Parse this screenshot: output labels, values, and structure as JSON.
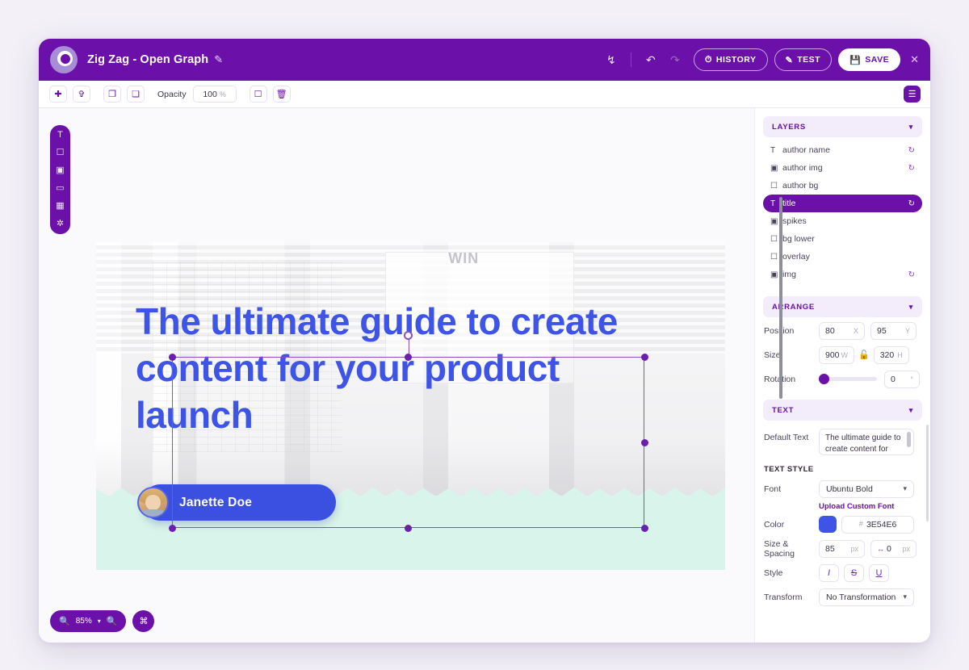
{
  "header": {
    "doc_title": "Zig Zag - Open Graph",
    "edit_icon": "pencil-icon",
    "download_icon": "download-icon",
    "undo_icon": "undo-icon",
    "redo_icon": "redo-icon",
    "history_label": "HISTORY",
    "history_icon": "clock-icon",
    "test_label": "TEST",
    "test_icon": "wand-icon",
    "save_label": "SAVE",
    "save_icon": "floppy-disk-icon",
    "close_icon": "close-icon"
  },
  "toolbar": {
    "align_horizontal_icon": "align-horizontal-icon",
    "align_vertical_icon": "align-vertical-icon",
    "bring_forward_icon": "bring-forward-icon",
    "send_backward_icon": "send-backward-icon",
    "opacity_label": "Opacity",
    "opacity_value": "100",
    "opacity_unit": "%",
    "duplicate_icon": "duplicate-icon",
    "delete_icon": "trash-icon",
    "menu_icon": "hamburger-menu-icon"
  },
  "left_tools": [
    {
      "name": "text-tool",
      "glyph": "T"
    },
    {
      "name": "rectangle-tool",
      "glyph": "▢"
    },
    {
      "name": "image-tool",
      "glyph": "▣"
    },
    {
      "name": "rounded-rect-tool",
      "glyph": "▭"
    },
    {
      "name": "qr-code-tool",
      "glyph": "▞"
    },
    {
      "name": "sticker-tool",
      "glyph": "✪"
    }
  ],
  "canvas": {
    "title_text": "The ultimate guide to create content for your product launch",
    "author_name": "Janette Doe",
    "photo_word": "WIN",
    "title_color": "#3E54E6",
    "author_chip_color": "#3b4fe0",
    "band_color": "#d9f4ea",
    "zoom_level": "85%",
    "zoom_out_icon": "zoom-out-icon",
    "zoom_in_icon": "zoom-in-icon",
    "zoom_chevron_icon": "chevron-down-icon",
    "fit_icon": "fit-to-screen-icon"
  },
  "layers_panel": {
    "title": "LAYERS",
    "chevron": "⌄",
    "items": [
      {
        "label": "author name",
        "icon": "text-layer-icon",
        "glyph": "T",
        "refresh": true,
        "active": false
      },
      {
        "label": "author img",
        "icon": "image-layer-icon",
        "glyph": "▣",
        "refresh": true,
        "active": false
      },
      {
        "label": "author bg",
        "icon": "shape-layer-icon",
        "glyph": "▢",
        "refresh": false,
        "active": false
      },
      {
        "label": "title",
        "icon": "text-layer-icon",
        "glyph": "T",
        "refresh": true,
        "active": true
      },
      {
        "label": "spikes",
        "icon": "image-layer-icon",
        "glyph": "▣",
        "refresh": false,
        "active": false
      },
      {
        "label": "bg lower",
        "icon": "shape-layer-icon",
        "glyph": "▢",
        "refresh": false,
        "active": false
      },
      {
        "label": "overlay",
        "icon": "shape-layer-icon",
        "glyph": "▢",
        "refresh": false,
        "active": false
      },
      {
        "label": "img",
        "icon": "image-layer-icon",
        "glyph": "▣",
        "refresh": true,
        "active": false
      }
    ]
  },
  "arrange_panel": {
    "title": "ARRANGE",
    "chevron": "⌄",
    "position_label": "Position",
    "position_x": "80",
    "position_x_unit": "X",
    "position_y": "95",
    "position_y_unit": "Y",
    "size_label": "Size",
    "size_w": "900",
    "size_w_unit": "W",
    "size_h": "320",
    "size_h_unit": "H",
    "lock_icon": "unlocked-padlock-icon",
    "rotation_label": "Rotation",
    "rotation_value": "0",
    "rotation_unit": "°"
  },
  "text_panel": {
    "title": "TEXT",
    "chevron": "⌄",
    "default_text_label": "Default Text",
    "default_text_value": "The ultimate guide to create content for your product launch",
    "text_style_label": "TEXT STYLE",
    "font_label": "Font",
    "font_value": "Ubuntu Bold",
    "upload_font_label": "Upload Custom Font",
    "color_label": "Color",
    "color_hash": "#",
    "color_value": "3E54E6",
    "color_swatch": "#3E54E6",
    "size_spacing_label": "Size & Spacing",
    "size_value": "85",
    "size_unit": "px",
    "spacing_icon": "letter-spacing-icon",
    "spacing_value": "0",
    "spacing_unit": "px",
    "style_label": "Style",
    "italic_glyph": "I",
    "strike_glyph": "S",
    "underline_glyph": "U",
    "transform_label": "Transform",
    "transform_value": "No Transformation"
  }
}
